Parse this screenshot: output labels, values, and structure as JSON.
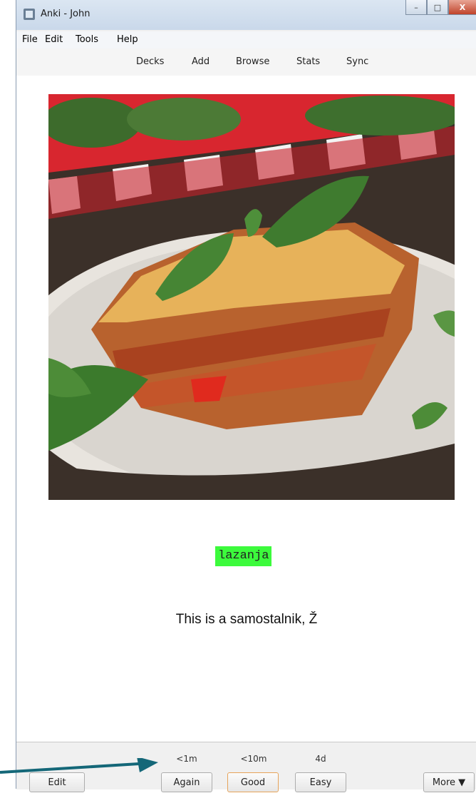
{
  "window": {
    "title": "Anki - John",
    "controls": {
      "minimize": "–",
      "maximize": "□",
      "close": "X"
    }
  },
  "menu": [
    "File",
    "Edit",
    "Tools",
    "Help"
  ],
  "toolbar": [
    "Decks",
    "Add",
    "Browse",
    "Stats",
    "Sync"
  ],
  "card": {
    "image_alt_icon": "lasagna-image",
    "word": "lazanja",
    "description": "This is a samostalnik, Ž"
  },
  "answer_bar": {
    "edit_label": "Edit",
    "intervals": [
      "<1m",
      "<10m",
      "4d"
    ],
    "buttons": [
      "Again",
      "Good",
      "Easy"
    ],
    "more_label": "More ▼"
  },
  "colors": {
    "highlight": "#3cfa3c",
    "arrow": "#146778",
    "default_button_border": "#e6a35a"
  }
}
